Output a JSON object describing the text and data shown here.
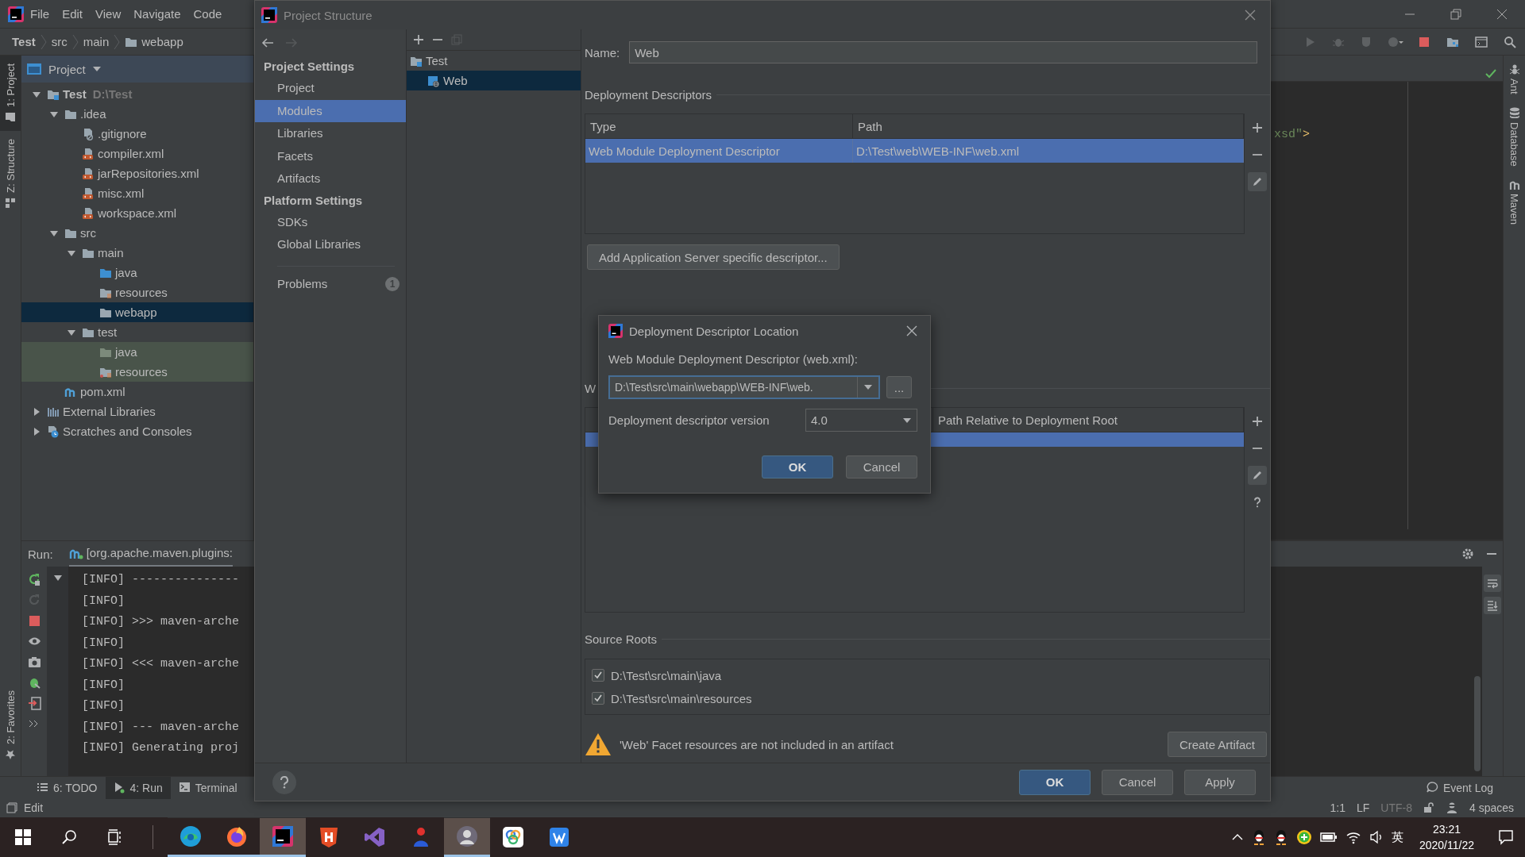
{
  "ide": {
    "menu": [
      "File",
      "Edit",
      "View",
      "Navigate",
      "Code"
    ],
    "breadcrumb": [
      {
        "label": "Test",
        "kind": "module"
      },
      {
        "label": "src",
        "kind": "plain"
      },
      {
        "label": "main",
        "kind": "plain"
      },
      {
        "label": "webapp",
        "kind": "folder"
      }
    ],
    "left_strip": [
      {
        "label": "1: Project",
        "selected": true
      },
      {
        "label": "Z: Structure",
        "selected": false
      }
    ],
    "favorites_tab": "2: Favorites",
    "project_panel": {
      "title": "Project",
      "tree": [
        {
          "label": "Test",
          "hint": "D:\\Test",
          "kind": "module",
          "expanded": true,
          "selected": false,
          "children": [
            {
              "label": ".idea",
              "kind": "folder",
              "expanded": true,
              "selected": false,
              "children": [
                {
                  "label": ".gitignore",
                  "kind": "ignore-file",
                  "selected": false
                },
                {
                  "label": "compiler.xml",
                  "kind": "xml-file",
                  "selected": false
                },
                {
                  "label": "jarRepositories.xml",
                  "kind": "xml-file",
                  "selected": false
                },
                {
                  "label": "misc.xml",
                  "kind": "xml-file",
                  "selected": false
                },
                {
                  "label": "workspace.xml",
                  "kind": "xml-file",
                  "selected": false
                }
              ]
            },
            {
              "label": "src",
              "kind": "folder",
              "expanded": true,
              "selected": false,
              "children": [
                {
                  "label": "main",
                  "kind": "folder",
                  "expanded": true,
                  "selected": false,
                  "children": [
                    {
                      "label": "java",
                      "kind": "source-folder",
                      "selected": false
                    },
                    {
                      "label": "resources",
                      "kind": "resources-folder",
                      "selected": false
                    },
                    {
                      "label": "webapp",
                      "kind": "folder",
                      "selected": true
                    }
                  ]
                },
                {
                  "label": "test",
                  "kind": "folder",
                  "expanded": true,
                  "selected": false,
                  "children": [
                    {
                      "label": "java",
                      "kind": "test-source-folder",
                      "selected": false
                    },
                    {
                      "label": "resources",
                      "kind": "test-resources-folder",
                      "selected": false
                    }
                  ]
                }
              ]
            },
            {
              "label": "pom.xml",
              "kind": "maven-file",
              "selected": false
            }
          ]
        },
        {
          "label": "External Libraries",
          "kind": "libraries",
          "expanded": false,
          "selected": false
        },
        {
          "label": "Scratches and Consoles",
          "kind": "scratches",
          "expanded": false,
          "selected": false
        }
      ]
    },
    "editor": {
      "code_line": [
        {
          "text": "xsd\"",
          "kind": "string"
        },
        {
          "text": ">",
          "kind": "tag"
        }
      ]
    },
    "run_panel": {
      "label": "Run:",
      "tab": "[org.apache.maven.plugins:",
      "console": [
        "[INFO] ---------------",
        "[INFO]",
        "[INFO] >>> maven-arche",
        "[INFO]",
        "[INFO] <<< maven-arche",
        "[INFO]",
        "[INFO]",
        "[INFO] --- maven-arche",
        "[INFO] Generating proj"
      ]
    },
    "right_strip": [
      {
        "label": "Ant",
        "kind": "ant"
      },
      {
        "label": "Database",
        "kind": "database"
      },
      {
        "label": "Maven",
        "kind": "maven"
      }
    ],
    "tool_tabs": [
      {
        "label": "6: TODO",
        "kind": "todo",
        "selected": false
      },
      {
        "label": "4: Run",
        "kind": "run",
        "selected": true
      },
      {
        "label": "Terminal",
        "kind": "terminal",
        "selected": false
      }
    ],
    "event_log": "Event Log",
    "status_bar": {
      "message": "Edit",
      "position": "1:1",
      "line_separator": "LF",
      "encoding": "UTF-8",
      "indent": "4 spaces"
    }
  },
  "project_structure": {
    "title": "Project Structure",
    "nav_groups": [
      {
        "title": "Project Settings",
        "items": [
          {
            "label": "Project",
            "selected": false
          },
          {
            "label": "Modules",
            "selected": true
          },
          {
            "label": "Libraries",
            "selected": false
          },
          {
            "label": "Facets",
            "selected": false
          },
          {
            "label": "Artifacts",
            "selected": false
          }
        ]
      },
      {
        "title": "Platform Settings",
        "items": [
          {
            "label": "SDKs",
            "selected": false
          },
          {
            "label": "Global Libraries",
            "selected": false
          }
        ]
      }
    ],
    "problems": {
      "label": "Problems",
      "badge": "1",
      "selected": false
    },
    "modules_tree": [
      {
        "label": "Test",
        "kind": "module",
        "selected": false,
        "children": [
          {
            "label": "Web",
            "kind": "web-facet",
            "selected": true
          }
        ]
      }
    ],
    "name": {
      "label": "Name:",
      "value": "Web"
    },
    "deployment_descriptors": {
      "title": "Deployment Descriptors",
      "columns": [
        "Type",
        "Path"
      ],
      "rows": [
        {
          "cells": [
            "Web Module Deployment Descriptor",
            "D:\\Test\\web\\WEB-INF\\web.xml"
          ],
          "selected": true
        }
      ]
    },
    "add_descriptor_button": "Add Application Server specific descriptor...",
    "web_resources": {
      "title": "W",
      "column_2": "Path Relative to Deployment Root",
      "rows": [
        {
          "selected": true
        }
      ]
    },
    "source_roots": {
      "title": "Source Roots",
      "items": [
        {
          "path": "D:\\Test\\src\\main\\java",
          "checked": true
        },
        {
          "path": "D:\\Test\\src\\main\\resources",
          "checked": true
        }
      ]
    },
    "warning": {
      "text": "'Web' Facet resources are not included in an artifact",
      "button": "Create Artifact"
    },
    "buttons": [
      {
        "label": "OK",
        "kind": "primary"
      },
      {
        "label": "Cancel",
        "kind": "normal"
      },
      {
        "label": "Apply",
        "kind": "normal"
      }
    ]
  },
  "descriptor_dialog": {
    "title": "Deployment Descriptor Location",
    "field_label": "Web Module Deployment Descriptor (web.xml):",
    "path": "D:\\Test\\src\\main\\webapp\\WEB-INF\\web.",
    "browse": "...",
    "version_label": "Deployment descriptor version",
    "version": "4.0",
    "buttons": [
      {
        "label": "OK",
        "kind": "primary"
      },
      {
        "label": "Cancel",
        "kind": "normal"
      }
    ]
  },
  "taskbar": {
    "apps": [
      {
        "kind": "edge",
        "running": true,
        "active": false
      },
      {
        "kind": "firefox",
        "running": true,
        "active": false
      },
      {
        "kind": "intellij",
        "running": true,
        "active": true
      },
      {
        "kind": "shield",
        "running": false,
        "active": false
      },
      {
        "kind": "ribbon",
        "running": false,
        "active": false
      },
      {
        "kind": "figure",
        "running": false,
        "active": false
      },
      {
        "kind": "avatar",
        "running": true,
        "active": true
      },
      {
        "kind": "rings",
        "running": false,
        "active": false
      },
      {
        "kind": "tile",
        "running": false,
        "active": false
      }
    ],
    "ime": "英",
    "time": "23:21",
    "date": "2020/11/22"
  }
}
